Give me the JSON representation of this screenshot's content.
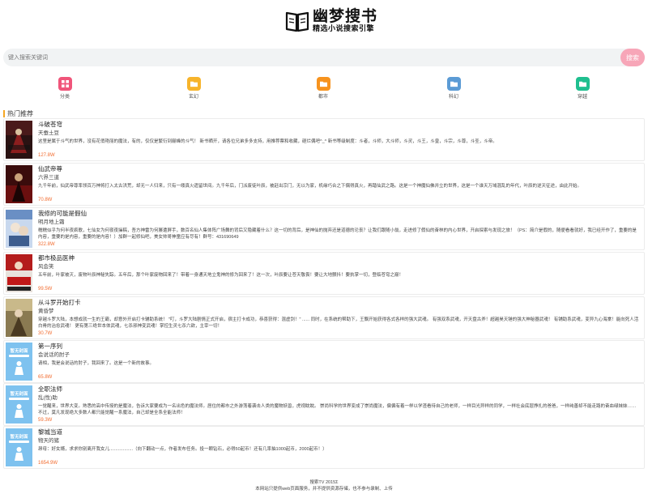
{
  "header": {
    "logo_title": "幽梦搜书",
    "logo_subtitle": "精选小说搜索引擎"
  },
  "search": {
    "placeholder": "键入搜索关键词",
    "button_label": "搜索"
  },
  "categories": [
    {
      "label": "分类",
      "color": "#f0557a",
      "icon": "grid-icon"
    },
    {
      "label": "玄幻",
      "color": "#f7b42c",
      "icon": "folder-icon"
    },
    {
      "label": "都市",
      "color": "#f7931e",
      "icon": "folder-icon"
    },
    {
      "label": "科幻",
      "color": "#5b9bd5",
      "icon": "folder-icon"
    },
    {
      "label": "穿越",
      "color": "#1fbf8f",
      "icon": "folder-icon"
    }
  ],
  "section_title": "热门推荐",
  "books": [
    {
      "title": "斗破苍穹",
      "author": "天蚕土豆",
      "desc": "这里是属于斗气的世界，没有花俏艳丽的魔法，有的，仅仅是繁衍到巅峰的斗气！ 新书晒开，请各位兄弟多多支持，用推荐票和收藏，砸烂偶吧^_^ 新书等级制度：斗者，斗师，大斗师，斗灵，斗王，斗皇，斗宗，斗尊，斗圣，斗帝。",
      "count": "127.8W",
      "cover": "dark-red"
    },
    {
      "title": "仙武帝尊",
      "author": "六界三道",
      "desc": "九千年前，仙武帝尊率领百万神将打入太古洪荒，却无一人归来，只有一缕真火遗留世间。九千年后，门派废徒叶辰，被赶出宗门，无以为家，机缘巧合之下偶得真火，再踏仙武之路。这是一个神魔仙佛并立的世界，这是一个谁天万域混乱的年代，叶辰的逆天征途，由此开始。",
      "count": "70.8W",
      "cover": "dark-crimson"
    },
    {
      "title": "我修的可能是假仙",
      "author": "明月地上霜",
      "desc": "糯糯似乎为何半夜疯歌，七仙女为何夜夜操稿，吾方神雷为何屡遭屏手，数百名仙人集体阵广场舞的背后又隐藏着什么？这一切的背后，是神仙的抛弃还是道德的沦丧？让我们跟随小翁，走进修了假仙的奋林的内心世界，开启探索与发现之旅！（PS：简介是假的，随便看看就好，我已经开作了，重要的是内容，重要的是内容，重要的是内容！）加群一起修仙吧，美女帅哥神童应有尽有！群号：431690649",
      "count": "322.8W",
      "cover": "light-anime"
    },
    {
      "title": "都市极品医神",
      "author": "风会笑",
      "desc": "五年前，叶家被灭，废物叶辰神秘失踪。五年后，那个叶家废物回来了！带着一身通天地立鬼神的修为回来了！这一次，叶辰要让苍天敬畏！要让大地颤抖！要执掌一切，登临苍穹之巅！",
      "count": "99.5W",
      "cover": "red-medical"
    },
    {
      "title": "从斗罗开始打卡",
      "author": "黄昏梦",
      "desc": "穿越斗罗大陆，本想成就一生的王霸，却意外开启打卡辅助系统！ \"叮，斗罗大陆剧情正式开启，宿主打卡成功，恭喜获得：混虚剑！\" ...... 同时，在系统的帮助下，王飘开始获得各式各样的强大武魂。 有强双系武魂，开天盘古斧！超越昊天锤的强大神秘器武魂！ 有铺助系武魂，变异九心海棠！能向死人活白骨的治愈武魂！ 更有第三绝世本体武魂，七杀邪神变武魂！掌控生灵七杀六欲，主宰一切！",
      "count": "30.7W",
      "cover": "olive-fantasy"
    },
    {
      "title": "第一序列",
      "author": "会说话的肘子",
      "desc": "请相，我是会说话的肘子，我回来了。这是一个新的故事。",
      "count": "65.8W",
      "cover": "placeholder"
    },
    {
      "title": "全职法师",
      "author": "乱(性)助",
      "desc": "一觉醒来，世界大变。熟悉的高中传授的是魔法，告诉大家要成为一名出色的魔法师。居住的都市之外游荡着袭击人类的魔物妖兽，虎视眈眈。 崇尚科学的世界变成了崇尚魔法，偏偏有着一样以学渣看待自己的老师，一样目光异样的同学，一样社会底层挣扎的爸爸，一样纯善却不能走路的奋血绿妹妹……不过，莫凡发现绝大多数人都只能觉醒一系魔法，自己却是全系全能法师！",
      "count": "59.3W",
      "cover": "placeholder"
    },
    {
      "title": "黎城当道",
      "author": "物天的猪",
      "desc": "昂母：好女婿，求求你别离开我女儿...................（向下翻动一点，作者发布任务。投一颗钻石，必得50起币！还有几率抽1000起币，2000起币！）",
      "count": "1654.9W",
      "cover": "placeholder"
    }
  ],
  "placeholder_cover_text": "暂无封面",
  "footer": {
    "line1": "搜索TV 2015Σ",
    "line2": "本网站只提供web页面服务，并不提供资源存储，也不参与录制、上传"
  }
}
